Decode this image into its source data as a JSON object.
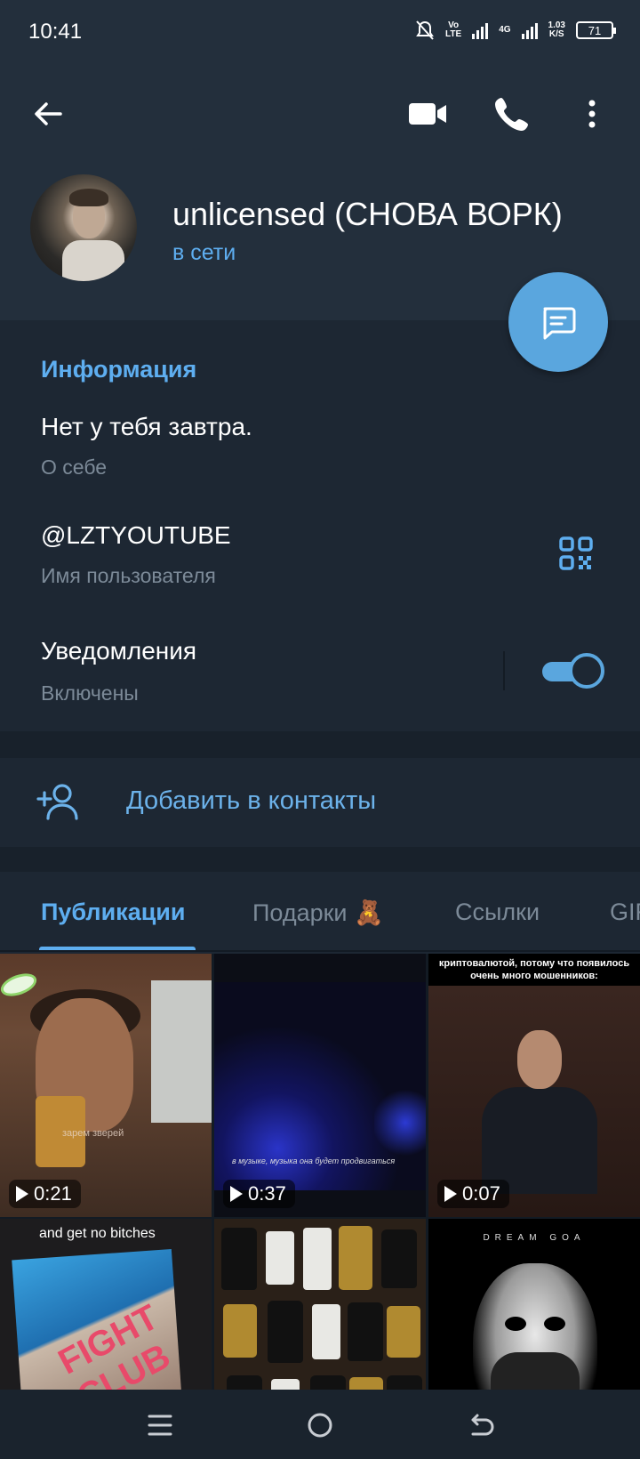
{
  "status_bar": {
    "time": "10:41",
    "volte": "Vo\nLTE",
    "network": "4G",
    "speed_value": "1.03",
    "speed_unit": "K/S",
    "battery": "71"
  },
  "header": {
    "name": "unlicensed (СНОВА ВОРК)",
    "status": "в сети",
    "icons": [
      "arrow-left-icon",
      "video-camera-icon",
      "phone-icon",
      "more-vertical-icon",
      "message-icon"
    ]
  },
  "info": {
    "title": "Информация",
    "bio": "Нет у тебя завтра.",
    "bio_label": "О себе",
    "username": "@LZTYOUTUBE",
    "username_label": "Имя пользователя",
    "notifications": "Уведомления",
    "notifications_state": "Включены",
    "notifications_enabled": true
  },
  "add_contact": {
    "label": "Добавить в контакты"
  },
  "tabs": {
    "items": [
      "Публикации",
      "Подарки 🧸",
      "Ссылки",
      "GIF"
    ],
    "active_index": 0
  },
  "media": {
    "tiles": [
      {
        "duration": "0:21",
        "caption": "зарем зверей"
      },
      {
        "duration": "0:37",
        "caption": "в музыке, музыка она будет продвигаться"
      },
      {
        "duration": "0:07",
        "caption": "криптовалютой, потому что появилось очень много мошенников:"
      },
      {
        "caption": "and get no bitches",
        "logo": "FIGHT CLUB"
      },
      {
        "caption": ""
      },
      {
        "caption": "DREAM GOA"
      }
    ]
  },
  "colors": {
    "accent": "#5eaef0",
    "header_bg": "#232f3c",
    "body_bg": "#1d2733",
    "fab": "#5aa6de"
  }
}
